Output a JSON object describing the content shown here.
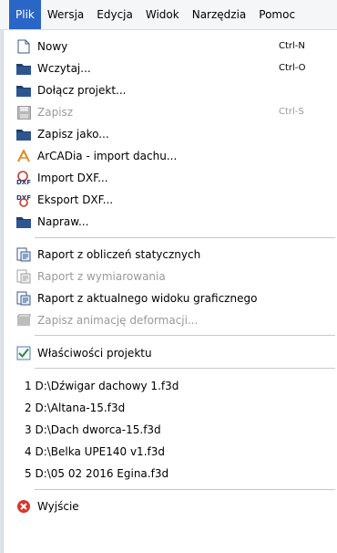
{
  "menubar": {
    "items": [
      {
        "label": "Plik"
      },
      {
        "label": "Wersja"
      },
      {
        "label": "Edycja"
      },
      {
        "label": "Widok"
      },
      {
        "label": "Narzędzia"
      },
      {
        "label": "Pomoc"
      }
    ]
  },
  "menu": {
    "items": [
      {
        "label": "Nowy",
        "shortcut": "Ctrl-N",
        "icon": "new-file-icon"
      },
      {
        "label": "Wczytaj...",
        "shortcut": "Ctrl-O",
        "icon": "open-folder-icon"
      },
      {
        "label": "Dołącz projekt...",
        "icon": "attach-folder-icon"
      },
      {
        "label": "Zapisz",
        "shortcut": "Ctrl-S",
        "icon": "save-icon",
        "disabled": true
      },
      {
        "label": "Zapisz jako...",
        "icon": "save-as-icon"
      },
      {
        "label": "ArCADia - import dachu...",
        "icon": "arcadia-icon"
      },
      {
        "label": "Import DXF...",
        "icon": "dxf-import-icon"
      },
      {
        "label": "Eksport DXF...",
        "icon": "dxf-export-icon"
      },
      {
        "label": "Napraw...",
        "icon": "repair-folder-icon"
      },
      {
        "label": "Raport z obliczeń statycznych",
        "icon": "report-icon"
      },
      {
        "label": "Raport z wymiarowania",
        "icon": "report-icon",
        "disabled": true
      },
      {
        "label": "Raport z aktualnego widoku graficznego",
        "icon": "report-icon"
      },
      {
        "label": "Zapisz animację deformacji...",
        "icon": "animation-icon",
        "disabled": true
      },
      {
        "label": "Właściwości projektu",
        "icon": "checkmark-icon"
      },
      {
        "label": "Wyjście",
        "icon": "exit-icon"
      }
    ],
    "recent": [
      {
        "label": "1 D:\\Dźwigar dachowy 1.f3d"
      },
      {
        "label": "2 D:\\Altana-15.f3d"
      },
      {
        "label": "3 D:\\Dach dworca-15.f3d"
      },
      {
        "label": "4 D:\\Belka UPE140 v1.f3d"
      },
      {
        "label": "5 D:\\05 02 2016 Egina.f3d"
      }
    ]
  },
  "colors": {
    "menubar_bg": "#f5f6f7",
    "active_menu": "#2a66c7",
    "disabled_text": "#9a9a9a",
    "exit_icon": "#d9352b"
  }
}
